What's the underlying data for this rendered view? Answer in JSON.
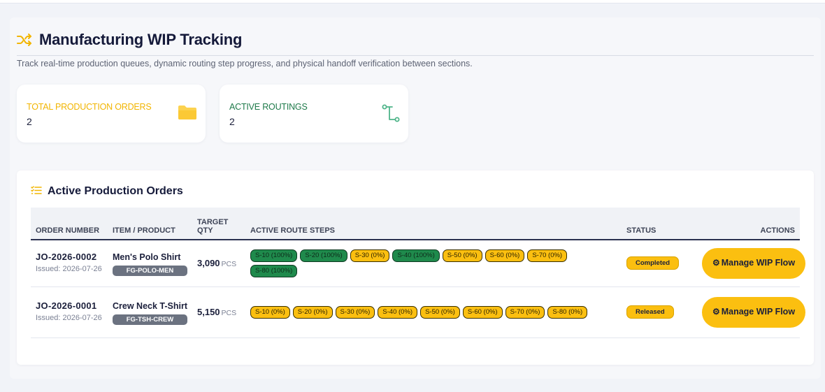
{
  "page": {
    "title": "Manufacturing WIP Tracking",
    "subtitle": "Track real-time production queues, dynamic routing step progress, and physical handoff verification between sections."
  },
  "stats": [
    {
      "label": "TOTAL PRODUCTION ORDERS",
      "value": "2",
      "icon": "folder-icon",
      "color": "#f2b500"
    },
    {
      "label": "ACTIVE ROUTINGS",
      "value": "2",
      "icon": "route-icon",
      "color": "#1e7a4a"
    }
  ],
  "panel": {
    "title": "Active Production Orders",
    "columns": {
      "order_number": "ORDER NUMBER",
      "item_product": "ITEM / PRODUCT",
      "target_qty": "TARGET QTY",
      "route_steps": "ACTIVE ROUTE STEPS",
      "status": "STATUS",
      "actions": "ACTIONS"
    },
    "rows": [
      {
        "order_no": "JO-2026-0002",
        "issued": "Issued: 2026-07-26",
        "item": "Men's Polo Shirt",
        "sku": "FG-POLO-MEN",
        "qty": "3,090",
        "unit": "PCS",
        "steps": [
          {
            "label": "S-10 (100%)",
            "state": "done"
          },
          {
            "label": "S-20 (100%)",
            "state": "done"
          },
          {
            "label": "S-30 (0%)",
            "state": "pending"
          },
          {
            "label": "S-40 (100%)",
            "state": "done"
          },
          {
            "label": "S-50 (0%)",
            "state": "pending"
          },
          {
            "label": "S-60 (0%)",
            "state": "pending"
          },
          {
            "label": "S-70 (0%)",
            "state": "pending"
          },
          {
            "label": "S-80 (100%)",
            "state": "done"
          }
        ],
        "status": "Completed",
        "action_label": "Manage WIP Flow"
      },
      {
        "order_no": "JO-2026-0001",
        "issued": "Issued: 2026-07-26",
        "item": "Crew Neck T-Shirt",
        "sku": "FG-TSH-CREW",
        "qty": "5,150",
        "unit": "PCS",
        "steps": [
          {
            "label": "S-10 (0%)",
            "state": "pending"
          },
          {
            "label": "S-20 (0%)",
            "state": "pending"
          },
          {
            "label": "S-30 (0%)",
            "state": "pending"
          },
          {
            "label": "S-40 (0%)",
            "state": "pending"
          },
          {
            "label": "S-50 (0%)",
            "state": "pending"
          },
          {
            "label": "S-60 (0%)",
            "state": "pending"
          },
          {
            "label": "S-70 (0%)",
            "state": "pending"
          },
          {
            "label": "S-80 (0%)",
            "state": "pending"
          }
        ],
        "status": "Released",
        "action_label": "Manage WIP Flow"
      }
    ]
  },
  "colors": {
    "accent": "#fbbf10",
    "done": "#1f8a4c",
    "title": "#151a3a"
  }
}
